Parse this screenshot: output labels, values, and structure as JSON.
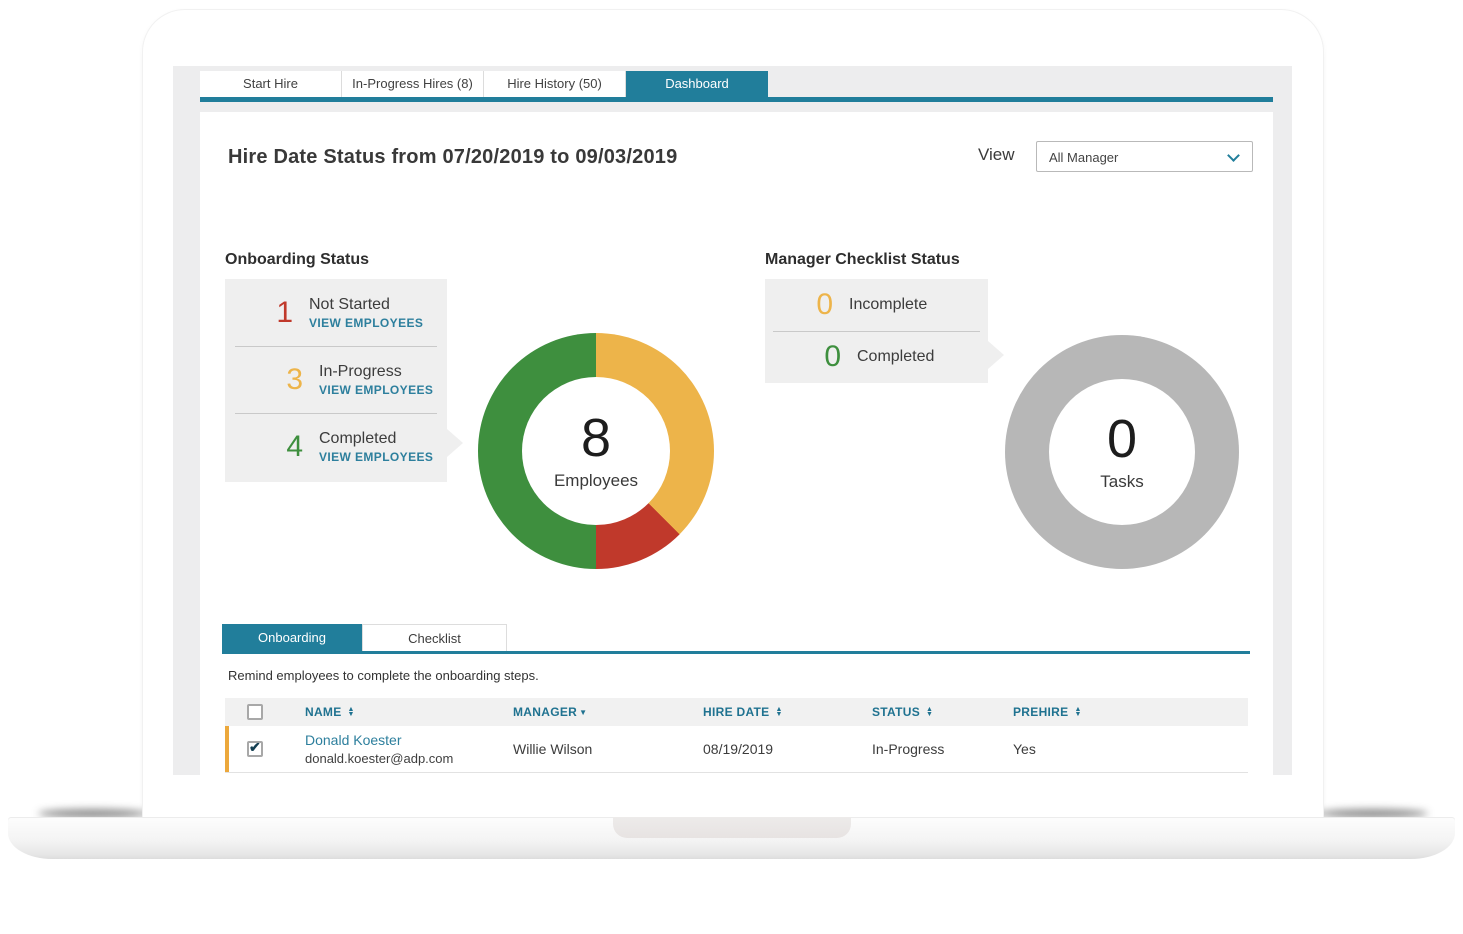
{
  "colors": {
    "accent_teal": "#217e9b",
    "link_teal": "#2d7f9d",
    "table_header_teal": "#1f7290",
    "red": "#c0392b",
    "amber": "#edb44a",
    "green": "#3e8f3e",
    "gray_ring": "#b7b7b7",
    "row_stripe_amber": "#eca83c"
  },
  "icons": {
    "sort_asc": "▲",
    "sort_desc": "▼",
    "check": "✔"
  },
  "top_tabs": [
    {
      "label": "Start Hire",
      "active": false
    },
    {
      "label": "In-Progress Hires (8)",
      "active": false
    },
    {
      "label": "Hire History (50)",
      "active": false
    },
    {
      "label": "Dashboard",
      "active": true
    }
  ],
  "header": {
    "title": "Hire Date Status from 07/20/2019 to 09/03/2019",
    "view_label": "View",
    "view_value": "All Manager"
  },
  "onboarding_status": {
    "heading": "Onboarding Status",
    "rows": [
      {
        "count": "1",
        "label": "Not Started",
        "link": "VIEW EMPLOYEES",
        "color": "#c0392b"
      },
      {
        "count": "3",
        "label": "In-Progress",
        "link": "VIEW EMPLOYEES",
        "color": "#edb44a"
      },
      {
        "count": "4",
        "label": "Completed",
        "link": "VIEW EMPLOYEES",
        "color": "#3e8f3e"
      }
    ]
  },
  "manager_checklist": {
    "heading": "Manager Checklist Status",
    "rows": [
      {
        "count": "0",
        "label": "Incomplete",
        "color": "#edb44a"
      },
      {
        "count": "0",
        "label": "Completed",
        "color": "#3e8f3e"
      }
    ]
  },
  "chart_data": [
    {
      "type": "pie",
      "title": "Onboarding Status donut",
      "center_value": "8",
      "center_label": "Employees",
      "total": 8,
      "segments": [
        {
          "label": "In-Progress",
          "value": 3,
          "color": "#edb44a"
        },
        {
          "label": "Not Started",
          "value": 1,
          "color": "#c0392b"
        },
        {
          "label": "Completed",
          "value": 4,
          "color": "#3e8f3e"
        }
      ],
      "legend_position": "none",
      "start_angle_deg": 0,
      "direction": "clockwise"
    },
    {
      "type": "pie",
      "title": "Manager Checklist Status donut",
      "center_value": "0",
      "center_label": "Tasks",
      "total": 0,
      "segments": [
        {
          "label": "No Tasks",
          "value": 1,
          "color": "#b7b7b7"
        }
      ],
      "legend_position": "none",
      "start_angle_deg": 0,
      "direction": "clockwise"
    }
  ],
  "lower_tabs": [
    {
      "label": "Onboarding",
      "active": true
    },
    {
      "label": "Checklist",
      "active": false
    }
  ],
  "table": {
    "note": "Remind employees to complete the onboarding steps.",
    "columns": [
      {
        "label": "NAME",
        "sort": "both"
      },
      {
        "label": "MANAGER",
        "sort": "desc"
      },
      {
        "label": "HIRE DATE",
        "sort": "both"
      },
      {
        "label": "STATUS",
        "sort": "both"
      },
      {
        "label": "PREHIRE",
        "sort": "both"
      }
    ],
    "rows": [
      {
        "checked": true,
        "name": "Donald Koester",
        "email": "donald.koester@adp.com",
        "manager": "Willie Wilson",
        "hire_date": "08/19/2019",
        "status": "In-Progress",
        "prehire": "Yes"
      }
    ]
  }
}
